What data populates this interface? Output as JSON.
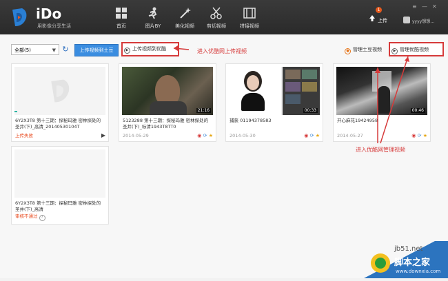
{
  "app": {
    "name": "iDo",
    "tagline": "用影像分享生活"
  },
  "nav": [
    {
      "label": "首页",
      "icon": "grid-icon"
    },
    {
      "label": "图片BY",
      "icon": "runner-icon"
    },
    {
      "label": "美化视频",
      "icon": "magic-wand-icon"
    },
    {
      "label": "剪切视频",
      "icon": "scissors-icon"
    },
    {
      "label": "拼接视频",
      "icon": "film-icon"
    }
  ],
  "header": {
    "upload_label": "上传",
    "upload_badge": "1",
    "username": "yyyy想想…",
    "window_controls": [
      "≡",
      "—",
      "✕"
    ]
  },
  "toolbar": {
    "filter_value": "全部(5)",
    "upload_tudou": "上传视频到土豆",
    "upload_youku": "上传视频到优酷",
    "manage_tudou": "管理土豆视频",
    "manage_youku": "管理优酷视频"
  },
  "annotations": {
    "upload_note": "进入优酷网上传视频",
    "manage_note": "进入优酷网管理视频"
  },
  "cards": [
    {
      "title": "6Y2X3T8 第十三期：探秘玛雅 密林探处的圣井(下)_高清_20140530104T",
      "meta": "上传失败",
      "duration": ""
    },
    {
      "title": "5123288 第十三期：探秘玛雅 密林探处的圣井(下)_标清1943T8TT0",
      "meta": "2014-05-29",
      "duration": "21:16"
    },
    {
      "title": "捕获 0119437858З",
      "meta": "2014-05-30",
      "duration": "00:33"
    },
    {
      "title": "开心麻花19424958",
      "meta": "2014-05-27",
      "duration": "00:46"
    },
    {
      "title": "6Y2X3T8 第十三期：探秘玛雅 密林探处的圣井(下)_高清",
      "meta": "审核不通过",
      "duration": ""
    }
  ],
  "watermark": {
    "site": "jb51.net",
    "brand": "脚本之家",
    "domain": "www.downxia.com"
  }
}
